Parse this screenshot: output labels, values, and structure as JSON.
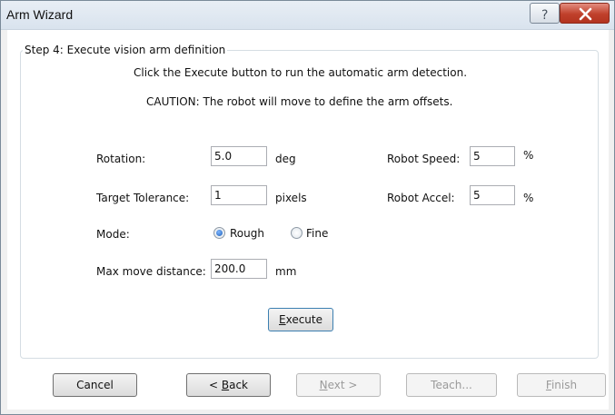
{
  "window": {
    "title": "Arm Wizard",
    "help_glyph": "?",
    "close_glyph": "X"
  },
  "step": {
    "title": "Step 4: Execute vision arm definition",
    "instruction": "Click the Execute button to run the automatic arm detection.",
    "caution": "CAUTION: The robot will move to define the arm offsets."
  },
  "fields": {
    "rotation": {
      "label": "Rotation:",
      "value": "5.0",
      "unit": "deg"
    },
    "target_tolerance": {
      "label": "Target Tolerance:",
      "value": "1",
      "unit": "pixels"
    },
    "robot_speed": {
      "label": "Robot Speed:",
      "value": "5",
      "unit": "%"
    },
    "robot_accel": {
      "label": "Robot Accel:",
      "value": "5",
      "unit": "%"
    },
    "max_move_distance": {
      "label": "Max move distance:",
      "value": "200.0",
      "unit": "mm"
    }
  },
  "mode": {
    "label": "Mode:",
    "options": [
      "Rough",
      "Fine"
    ],
    "selected": "Rough"
  },
  "execute_button": {
    "mnemonic": "E",
    "rest": "xecute"
  },
  "footer": {
    "cancel": "Cancel",
    "back": {
      "prefix": "< ",
      "mnemonic": "B",
      "rest": "ack"
    },
    "next": {
      "mnemonic": "N",
      "rest": "ext >"
    },
    "teach": "Teach...",
    "finish": {
      "mnemonic": "F",
      "rest": "inish"
    }
  }
}
